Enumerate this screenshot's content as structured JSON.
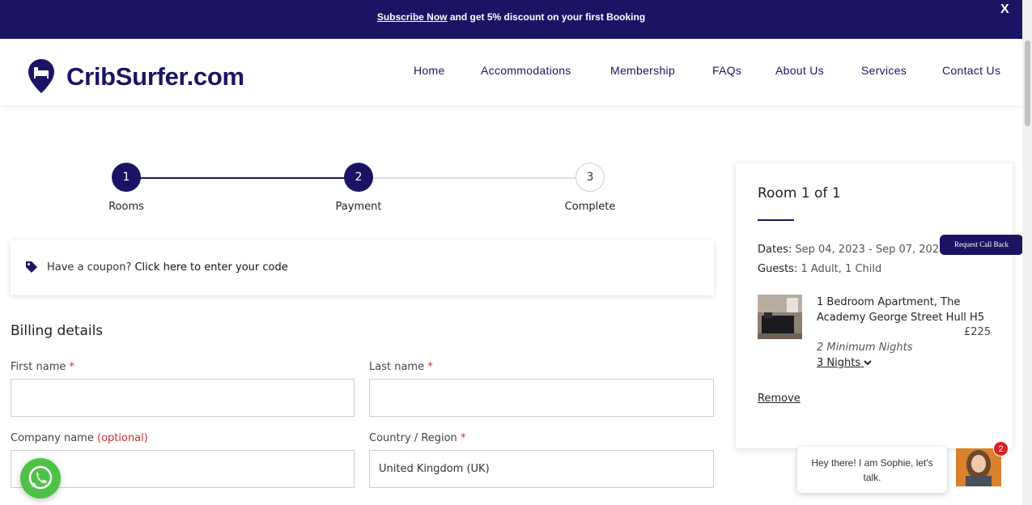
{
  "announcement": {
    "link_text": "Subscribe Now",
    "text": " and get 5% discount on your first Booking",
    "close": "X"
  },
  "header": {
    "logo_text": "CribSurfer.com",
    "nav": [
      "Home",
      "Accommodations",
      "Membership",
      "FAQs",
      "About Us",
      "Services",
      "Contact Us"
    ]
  },
  "stepper": {
    "steps": [
      {
        "number": "1",
        "label": "Rooms",
        "state": "done"
      },
      {
        "number": "2",
        "label": "Payment",
        "state": "done"
      },
      {
        "number": "3",
        "label": "Complete",
        "state": "todo"
      }
    ]
  },
  "coupon": {
    "prefix": "Have a coupon? ",
    "link": "Click here to enter your code"
  },
  "billing": {
    "title": "Billing details",
    "first_name_label": "First name",
    "last_name_label": "Last name",
    "company_label": "Company name",
    "optional": "(optional)",
    "country_label": "Country / Region",
    "required_mark": "*",
    "first_name_value": "",
    "last_name_value": "",
    "company_value": "",
    "country_value": "United Kingdom (UK)"
  },
  "summary": {
    "title": "Room 1 of 1",
    "dates_label": "Dates:",
    "dates_value": " Sep 04, 2023 - Sep 07, 2023",
    "guests_label": "Guests:",
    "guests_value": " 1 Adult, 1 Child",
    "room_name": "1 Bedroom Apartment, The Academy George Street Hull H5",
    "price": "£225",
    "min_nights": "2 Minimum Nights",
    "nights": "3 Nights",
    "remove": "Remove"
  },
  "widgets": {
    "callback": "Request Call Back",
    "chat_message": "Hey there! I am Sophie, let's talk.",
    "chat_badge": "2"
  },
  "colors": {
    "brand": "#1b1464",
    "required": "#d32f2f",
    "whatsapp": "#4dc247"
  }
}
